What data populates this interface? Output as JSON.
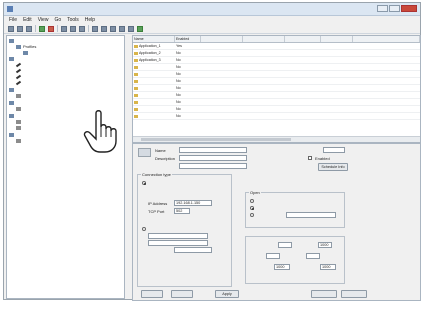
{
  "titlebar": {
    "title": ""
  },
  "menus": [
    "File",
    "Edit",
    "View",
    "Go",
    "Tools",
    "Help"
  ],
  "tree": {
    "items": [
      {
        "id": "root1",
        "label": ""
      },
      {
        "id": "profiles",
        "label": "Profiles"
      },
      {
        "id": "selected",
        "label": ""
      },
      {
        "id": "group2",
        "label": ""
      },
      {
        "id": "item1",
        "label": ""
      },
      {
        "id": "item2",
        "label": ""
      },
      {
        "id": "item3",
        "label": ""
      },
      {
        "id": "item4",
        "label": ""
      },
      {
        "id": "group3",
        "label": ""
      },
      {
        "id": "item5",
        "label": ""
      },
      {
        "id": "group4",
        "label": ""
      },
      {
        "id": "item6",
        "label": ""
      },
      {
        "id": "group5",
        "label": ""
      },
      {
        "id": "item7",
        "label": ""
      },
      {
        "id": "item8",
        "label": ""
      },
      {
        "id": "group6",
        "label": ""
      },
      {
        "id": "item9",
        "label": ""
      }
    ]
  },
  "grid": {
    "columns": [
      "Name",
      "Enabled",
      "",
      "",
      "",
      "",
      ""
    ],
    "rows": [
      {
        "name": "Application_1",
        "enabled": "Yes"
      },
      {
        "name": "Application_2",
        "enabled": "No"
      },
      {
        "name": "Application_3",
        "enabled": "No"
      },
      {
        "name": "",
        "enabled": "No"
      },
      {
        "name": "",
        "enabled": "No"
      },
      {
        "name": "",
        "enabled": "No"
      },
      {
        "name": "",
        "enabled": "No"
      },
      {
        "name": "",
        "enabled": "No"
      },
      {
        "name": "",
        "enabled": "No"
      },
      {
        "name": "",
        "enabled": "No"
      },
      {
        "name": "",
        "enabled": "No"
      }
    ]
  },
  "detail": {
    "name_label": "Name",
    "name_value": "",
    "description_label": "Description",
    "id_label": "",
    "id_value": "",
    "enabled_label": "Enabled",
    "schedule_button": "Schedule Info",
    "connection_group": "Connection type",
    "ethernet_option": "",
    "ethernet_note_1": "",
    "ethernet_note_2": "",
    "ip_label": "IP Address",
    "ip_value": "192.168.1.150",
    "port_label": "TCP Port",
    "port_value": "502",
    "serial_option": "",
    "serial_sub_label": "",
    "serial_dropdown": "",
    "open_group": "Open",
    "open_opt1": "",
    "open_opt2": "",
    "open_opt3": "",
    "config_group": "",
    "f1_label": "",
    "f1_value": "",
    "f2_label": "",
    "f2_value": "1000",
    "f3_label": "",
    "f3_value": "",
    "f4_label": "",
    "f4_value": "",
    "f5_label": "",
    "f5_value": "1000",
    "f6_label": "",
    "f6_value": "1000",
    "btn_left1": "",
    "btn_left2": "",
    "btn_apply": "Apply",
    "btn_right1": "",
    "btn_right2": ""
  }
}
